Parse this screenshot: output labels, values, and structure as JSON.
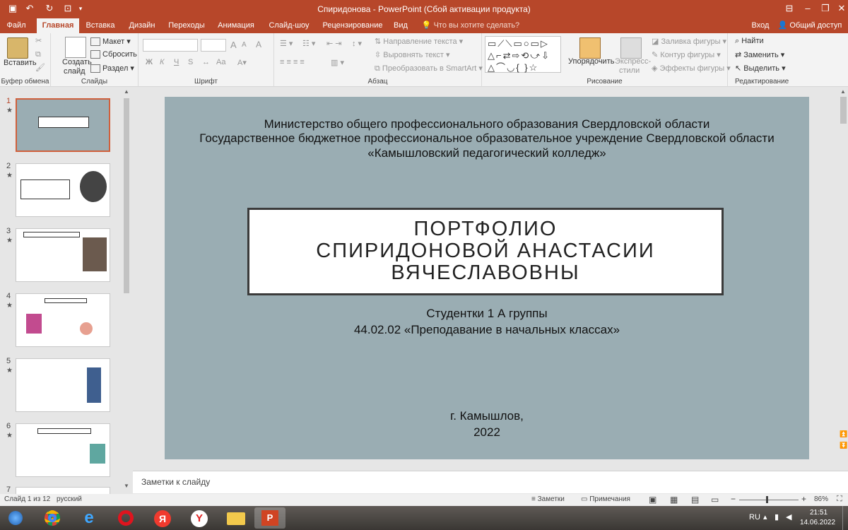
{
  "window": {
    "title": "Спиридонова - PowerPoint (Сбой активации продукта)",
    "signin": "Вход",
    "share": "Общий доступ"
  },
  "tabs": [
    "Файл",
    "Главная",
    "Вставка",
    "Дизайн",
    "Переходы",
    "Анимация",
    "Слайд-шоу",
    "Рецензирование",
    "Вид"
  ],
  "tell_me": "Что вы хотите сделать?",
  "ribbon": {
    "clipboard": {
      "paste": "Вставить",
      "label": "Буфер обмена"
    },
    "slides": {
      "new_slide_1": "Создать",
      "new_slide_2": "слайд",
      "layout": "Макет",
      "reset": "Сбросить",
      "section": "Раздел",
      "label": "Слайды"
    },
    "font": {
      "label": "Шрифт",
      "bold": "Ж",
      "italic": "К",
      "underline": "Ч",
      "strike": "S",
      "grow": "A",
      "shrink": "A",
      "clear": "A"
    },
    "paragraph": {
      "text_direction": "Направление текста",
      "align_text": "Выровнять текст",
      "smartart": "Преобразовать в SmartArt",
      "label": "Абзац"
    },
    "drawing": {
      "arrange": "Упорядочить",
      "quick_styles_1": "Экспресс-",
      "quick_styles_2": "стили",
      "fill": "Заливка фигуры",
      "outline": "Контур фигуры",
      "effects": "Эффекты фигуры",
      "label": "Рисование"
    },
    "editing": {
      "find": "Найти",
      "replace": "Заменить",
      "select": "Выделить",
      "label": "Редактирование"
    }
  },
  "thumbnails": [
    {
      "num": "1",
      "star": "★"
    },
    {
      "num": "2",
      "star": "★"
    },
    {
      "num": "3",
      "star": "★"
    },
    {
      "num": "4",
      "star": "★"
    },
    {
      "num": "5",
      "star": "★"
    },
    {
      "num": "6",
      "star": "★"
    },
    {
      "num": "7",
      "star": ""
    }
  ],
  "slide": {
    "header": [
      "Министерство общего профессионального образования Свердловской области",
      "Государственное бюджетное профессиональное образовательное учреждение Свердловской области",
      "«Камышловский педагогический колледж»"
    ],
    "title": [
      "ПОРТФОЛИО",
      "СПИРИДОНОВОЙ АНАСТАСИИ",
      "ВЯЧЕСЛАВОВНЫ"
    ],
    "subtitle": [
      "Студентки 1 А группы",
      "44.02.02 «Преподавание в начальных классах»"
    ],
    "footer": [
      "г. Камышлов,",
      "2022"
    ]
  },
  "notes_placeholder": "Заметки к слайду",
  "status": {
    "slide_info": "Слайд 1 из 12",
    "language": "русский",
    "notes": "Заметки",
    "comments": "Примечания",
    "zoom": "86%"
  },
  "taskbar": {
    "lang": "RU",
    "time": "21:51",
    "date": "14.06.2022"
  },
  "colors": {
    "accent": "#b7472a",
    "slide_bg": "#9aadb3"
  }
}
